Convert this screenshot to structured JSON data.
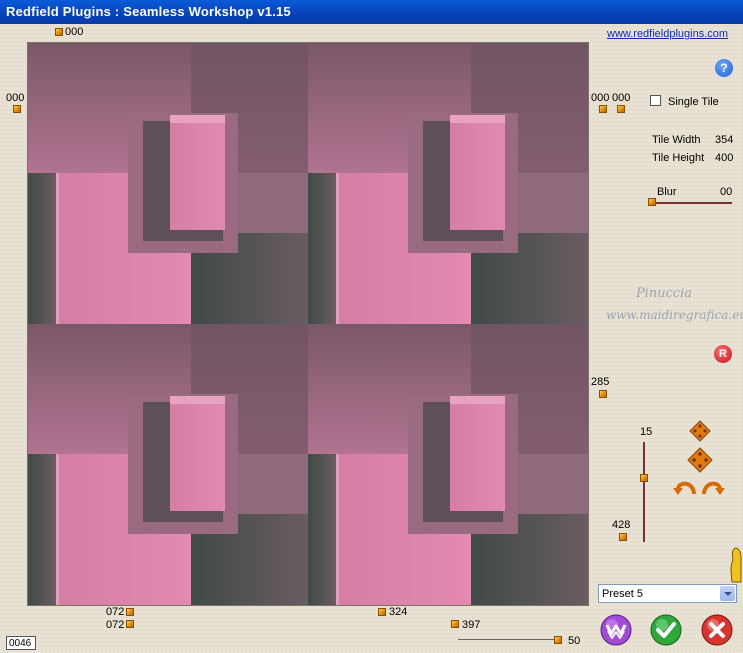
{
  "window": {
    "title": "Redfield Plugins : Seamless Workshop v1.15"
  },
  "link": "www.redfieldplugins.com",
  "help_label": "?",
  "reset_label": "R",
  "markers": {
    "top": "000",
    "left": "000",
    "right_a": "000",
    "right_b": "000",
    "right_285": "285",
    "bottom_left_1": "072",
    "bottom_left_2": "072",
    "bottom_mid": "324",
    "bottom_397": "397"
  },
  "single_tile": {
    "label": "Single Tile",
    "checked": false
  },
  "tile": {
    "width_label": "Tile Width",
    "width_value": "354",
    "height_label": "Tile Height",
    "height_value": "400"
  },
  "blur": {
    "label": "Blur",
    "value": "00"
  },
  "watermark": {
    "line1": "Pinuccia",
    "line2": "www.maidiregrafica.eu"
  },
  "vslider": {
    "top_value": "15",
    "bottom_value": "428"
  },
  "preset": {
    "selected": "Preset 5"
  },
  "bottom_slider_value": "50",
  "counter": "0046"
}
